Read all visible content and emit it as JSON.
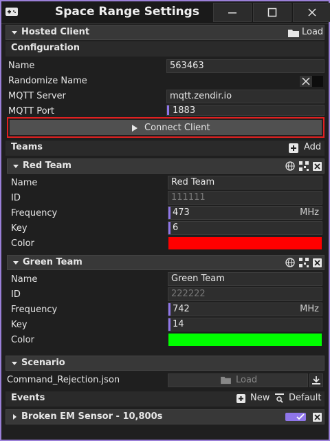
{
  "window": {
    "title": "Space Range Settings"
  },
  "hosted_client": {
    "header": "Hosted Client",
    "load_label": "Load",
    "configuration_label": "Configuration",
    "name_label": "Name",
    "name_value": "563463",
    "randomize_label": "Randomize Name",
    "mqtt_server_label": "MQTT Server",
    "mqtt_server_value": "mqtt.zendir.io",
    "mqtt_port_label": "MQTT Port",
    "mqtt_port_value": "1883",
    "connect_label": "Connect Client"
  },
  "teams": {
    "header": "Teams",
    "add_label": "Add",
    "items": [
      {
        "name_header": "Red Team",
        "name_label": "Name",
        "name_value": "Red Team",
        "id_label": "ID",
        "id_value": "111111",
        "frequency_label": "Frequency",
        "frequency_value": "473",
        "frequency_unit": "MHz",
        "key_label": "Key",
        "key_value": "6",
        "color_label": "Color",
        "color": "#ff0000"
      },
      {
        "name_header": "Green Team",
        "name_label": "Name",
        "name_value": "Green Team",
        "id_label": "ID",
        "id_value": "222222",
        "frequency_label": "Frequency",
        "frequency_value": "742",
        "frequency_unit": "MHz",
        "key_label": "Key",
        "key_value": "14",
        "color_label": "Color",
        "color": "#00ff00"
      }
    ]
  },
  "scenario": {
    "header": "Scenario",
    "file_name": "Command_Rejection.json",
    "load_label": "Load"
  },
  "events": {
    "header": "Events",
    "new_label": "New",
    "default_label": "Default",
    "items": [
      {
        "label": "Broken EM Sensor - 10,800s",
        "enabled_color": "#8f76ea"
      }
    ]
  },
  "colors": {
    "accent": "#8f76ea",
    "highlight_border": "#e02020",
    "window_border": "#9b80d8"
  }
}
